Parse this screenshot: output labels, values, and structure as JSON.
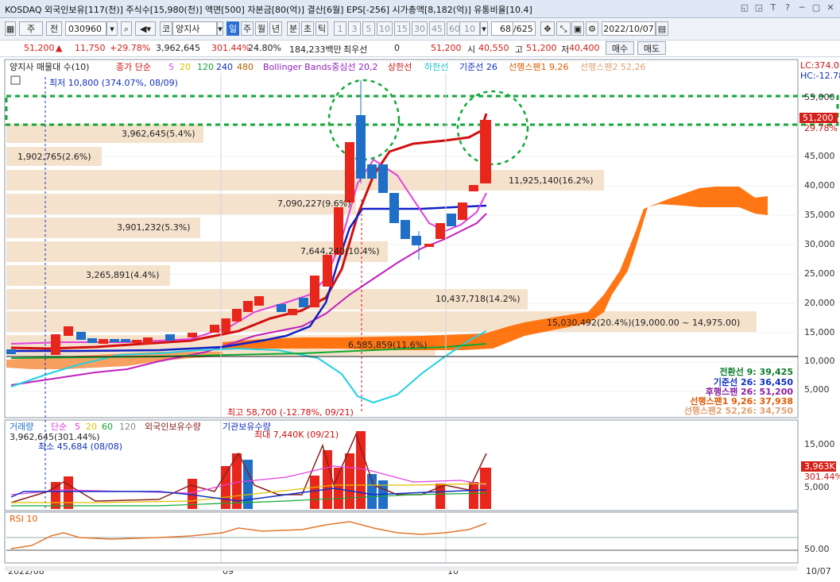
{
  "window": {
    "title": "KOSDAQ 외국인보유[117(천)] 주식수[15,980(천)] 액면[500] 자본금[80(억)] 결산[6월] EPS[-256] 시가총액[8,182(억)] 유통비율[10.4]",
    "buttons": [
      "◱",
      "◲",
      "T",
      "?",
      "─",
      "▢",
      "✕"
    ]
  },
  "toolbar": {
    "market": "주",
    "prev": "전",
    "code": "030960",
    "name_prefix": "코",
    "name": "양지사",
    "periods": [
      "일",
      "주",
      "월",
      "년",
      "분",
      "초",
      "틱"
    ],
    "selected_period": "일",
    "intervals": [
      "1",
      "3",
      "5",
      "10",
      "15",
      "30",
      "45",
      "60"
    ],
    "interval_value": "10",
    "count": "68",
    "count_total": "/625",
    "date": "2022/10/07"
  },
  "quote": {
    "price": "51,200",
    "change": "11,750",
    "change_pct": "+29.78%",
    "volume": "3,962,645",
    "volume_pct": "301.44%",
    "turnover": "24.80%",
    "amount": "184,233백만",
    "priority": "최우선",
    "zero": "0",
    "bid": "51,200",
    "open_label": "시",
    "open": "40,550",
    "high_label": "고",
    "high": "51,200",
    "low_label": "저",
    "low": "40,400",
    "buy": "매수",
    "sell": "매도"
  },
  "legend": {
    "main_title": "양지사 매물대 수(10)",
    "ma_label": "종가 단순",
    "ma_periods": [
      "5",
      "20",
      "120",
      "240",
      "480"
    ],
    "bollinger": "Bollinger Bands중심선 20,2",
    "upper": "상한선",
    "lower": "하한선",
    "base": "기준선 26",
    "span1": "선행스팬1 9,26",
    "span2": "선행스팬2 52,26",
    "lc": "LC:374.07",
    "hc": "HC:-12.78"
  },
  "annotations": {
    "low_label": "최저 10,800 (374.07%, 08/09)",
    "high_label": "최고 58,700 (-12.78%, 09/21)"
  },
  "volume_profile": [
    {
      "label": "3,962,645(5.4%)"
    },
    {
      "label": "1,902,765(2.6%)"
    },
    {
      "label": "11,925,140(16.2%)"
    },
    {
      "label": "7,090,227(9.6%)"
    },
    {
      "label": "3,901,232(5.3%)"
    },
    {
      "label": "7,644,240(10.4%)"
    },
    {
      "label": "3,265,891(4.4%)"
    },
    {
      "label": "10,437,718(14.2%)"
    },
    {
      "label": "15,030,492(20.4%)(19,000.00 ~ 14,975.00)"
    },
    {
      "label": "6,585,859(11.6%)"
    }
  ],
  "price_axis": [
    "55,000",
    "50,000",
    "45,000",
    "40,000",
    "35,000",
    "30,000",
    "25,000",
    "20,000",
    "15,000",
    "10,000",
    "5,000"
  ],
  "price_tags": {
    "current": "51,200",
    "pct": "29.78%"
  },
  "ichimoku_values": [
    {
      "label": "전환선 9: 39,425",
      "color": "#0a7a2a"
    },
    {
      "label": "기준선 26: 36,450",
      "color": "#1030c0"
    },
    {
      "label": "후행스팬 26: 51,200",
      "color": "#8a20a0"
    },
    {
      "label": "선행스팬1 9,26: 37,938",
      "color": "#e05a00"
    },
    {
      "label": "선행스팬2 52,26: 34,750",
      "color": "#e0a070"
    }
  ],
  "volume_panel": {
    "legend_vol": "거래량",
    "legend_ma": "단순",
    "ma_periods": [
      "5",
      "20",
      "60",
      "120"
    ],
    "foreign": "외국인보유수량",
    "inst": "기관보유수량",
    "current": "3,962,645(301.44%)",
    "min_label": "최소 45,684 (08/08)",
    "max_label": "최대 7,440K (09/21)",
    "axis": [
      "15,000",
      "10,000",
      "5,000"
    ],
    "tag_value": "3,963K",
    "tag_pct": "301.44%"
  },
  "rsi_panel": {
    "label": "RSI 10",
    "axis": "50.00"
  },
  "date_axis": [
    "2022/08",
    "09",
    "10",
    "10/07"
  ],
  "colors": {
    "up": "#e8261c",
    "down": "#1f6fc8",
    "ma5": "#e040c0",
    "ma20": "#1a30d0",
    "bollinger": "#d01010",
    "profile": "#f5e2cc"
  }
}
